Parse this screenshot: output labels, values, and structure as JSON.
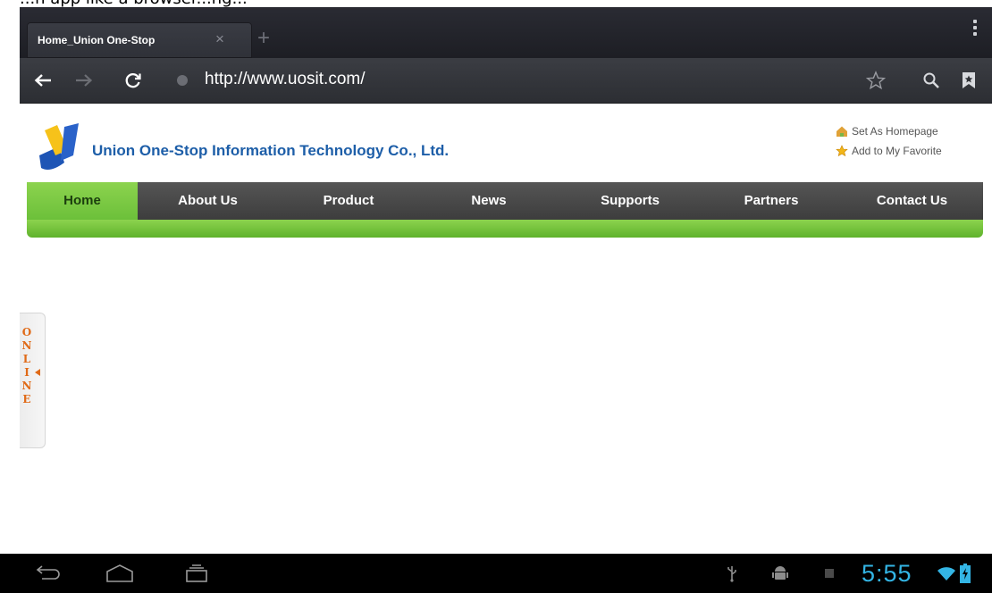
{
  "caption": "...n app like a browser...ng...",
  "browser": {
    "tab_title": "Home_Union One-Stop",
    "tab_close": "×",
    "new_tab": "+",
    "url": "http://www.uosit.com/"
  },
  "site": {
    "company_name": "Union One-Stop Information Technology Co., Ltd.",
    "top_links": [
      "Set As Homepage",
      "Add to My Favorite"
    ],
    "nav": [
      "Home",
      "About Us",
      "Product",
      "News",
      "Supports",
      "Partners",
      "Contact Us"
    ],
    "active_nav": "Home",
    "online_tab": [
      "O",
      "N",
      "L",
      "I",
      "N",
      "E"
    ]
  },
  "system": {
    "time": "5:55"
  },
  "colors": {
    "nav_green": "#6cc03a",
    "nav_dark": "#4a4a4a",
    "company_blue": "#1d5ea8",
    "online_orange": "#e06a17",
    "clock_blue": "#33b5e5"
  }
}
